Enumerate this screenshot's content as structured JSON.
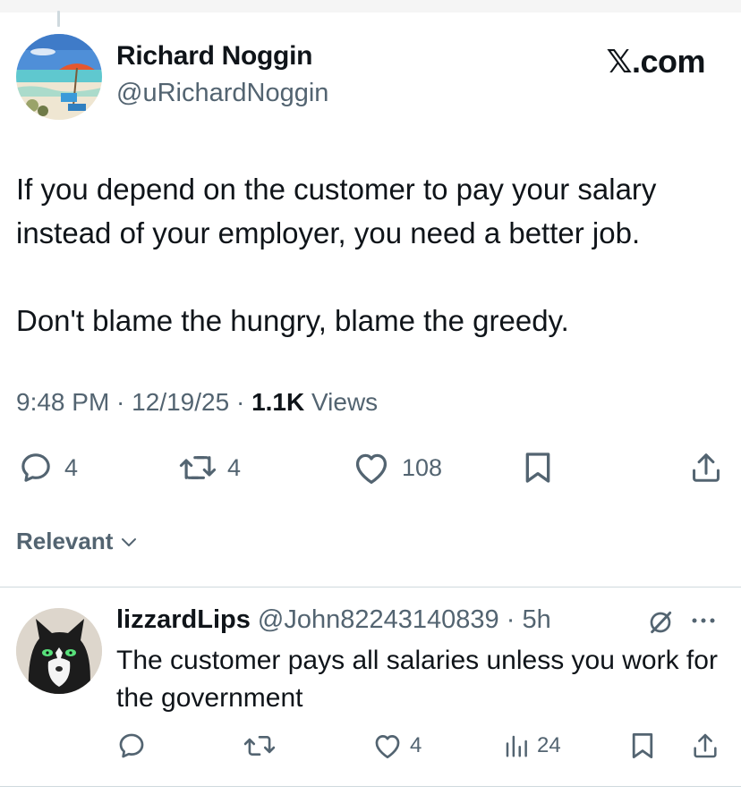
{
  "brand": {
    "label": "𝕏.com"
  },
  "author": {
    "name": "Richard Noggin",
    "handle": "@uRichardNoggin",
    "avatar_icon": "beach-umbrella-avatar"
  },
  "tweet": {
    "paragraph_1": "If you depend on the customer to pay your salary instead of your employer, you need a better job.",
    "paragraph_2": "Don't blame the hungry, blame the greedy.",
    "time": "9:48 PM",
    "sep_1": " · ",
    "date": "12/19/25",
    "sep_2": " · ",
    "views_count": "1.1K",
    "views_label": " Views"
  },
  "actions": {
    "replies": "4",
    "reposts": "4",
    "likes": "108"
  },
  "sort": {
    "label": "Relevant"
  },
  "reply": {
    "name": "lizzardLips",
    "handle": "@John82243140839",
    "dot": " · ",
    "time": "5h",
    "text": "The customer pays all salaries unless you work for the government",
    "avatar_icon": "cat-avatar",
    "actions": {
      "replies": "",
      "reposts": "",
      "likes": "4",
      "views": "24"
    }
  },
  "colors": {
    "text": "#0f1419",
    "secondary": "#536471",
    "divider": "#cfd9de"
  }
}
